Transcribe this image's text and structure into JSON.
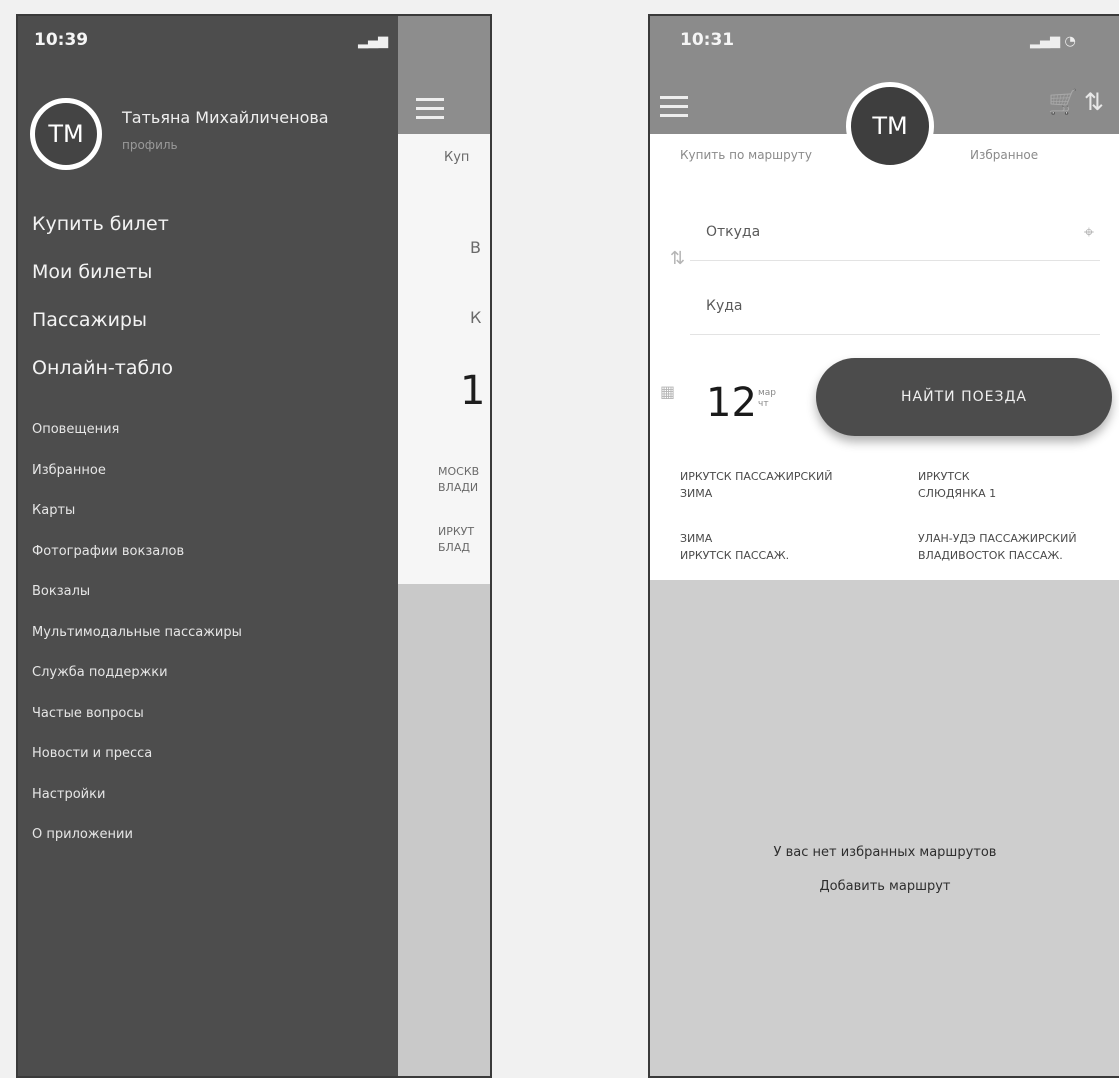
{
  "left_phone": {
    "status_time": "10:39",
    "user": {
      "initials": "ТМ",
      "name": "Татьяна Михайличенова",
      "profile_link": "профиль"
    },
    "menu_main": [
      "Купить билет",
      "Мои билеты",
      "Пассажиры",
      "Онлайн-табло"
    ],
    "menu_secondary": [
      "Оповещения",
      "Избранное",
      "Карты",
      "Фотографии вокзалов",
      "Вокзалы",
      "Мультимодальные пассажиры",
      "Служба поддержки",
      "Частые вопросы",
      "Новости и пресса",
      "Настройки",
      "О приложении"
    ],
    "underlying_fragments": {
      "tab": "Куп",
      "from_fragment": "В",
      "to_fragment": "К",
      "date_fragment": "1",
      "route1_fragment": [
        "МОСКВ",
        "ВЛАДИ"
      ],
      "route2_fragment": [
        "ИРКУТ",
        "БЛАД"
      ]
    }
  },
  "right_phone": {
    "status_time": "10:31",
    "avatar_initials": "ТМ",
    "tabs": [
      "Купить по маршруту",
      "Избранное"
    ],
    "from_label": "Откуда",
    "to_label": "Куда",
    "date_day": "12",
    "date_month": [
      "мар",
      "чт"
    ],
    "find_button": "НАЙТИ ПОЕЗДА",
    "routes": [
      {
        "line1": "ИРКУТСК ПАССАЖИРСКИЙ",
        "line2": "ЗИМА"
      },
      {
        "line1": "ИРКУТСК",
        "line2": "СЛЮДЯНКА 1"
      },
      {
        "line1": "ЗИМА",
        "line2": "ИРКУТСК ПАССАЖ."
      },
      {
        "line1": "УЛАН-УДЭ ПАССАЖИРСКИЙ",
        "line2": "ВЛАДИВОСТОК ПАССАЖ."
      }
    ],
    "empty_message": "У вас нет избранных маршрутов",
    "add_route": "Добавить маршрут"
  }
}
